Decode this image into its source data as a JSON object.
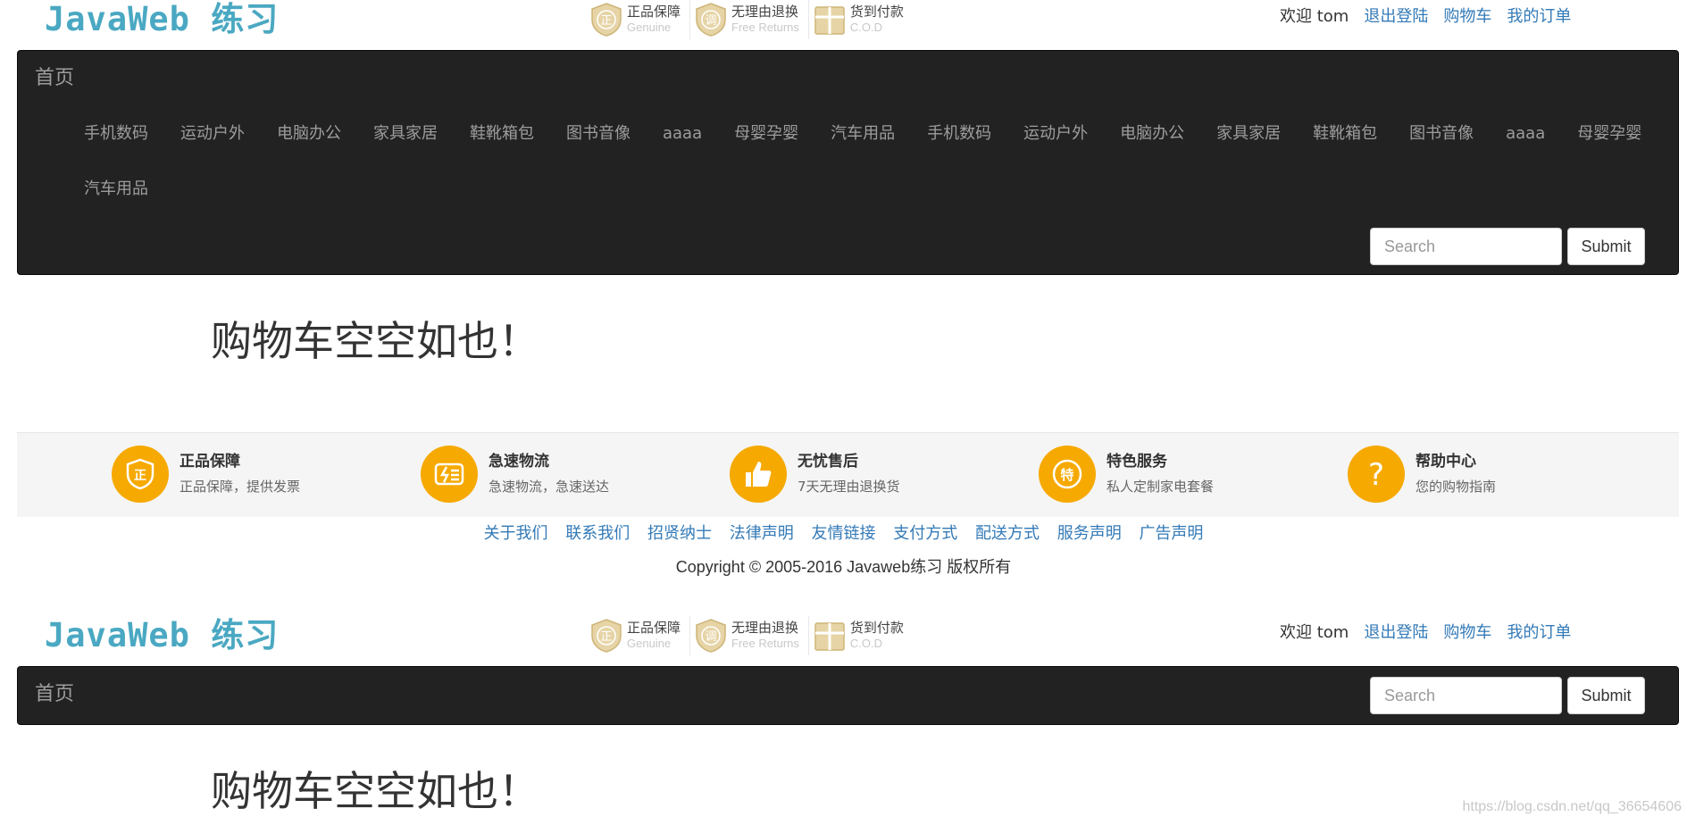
{
  "header": {
    "logo": "JavaWeb 练习",
    "badges": [
      {
        "main": "正品保障",
        "sub": "Genuine",
        "icon": "shield-zheng-icon",
        "glyph": "正"
      },
      {
        "main": "无理由退换",
        "sub": "Free Returns",
        "icon": "shield-tiao-icon",
        "glyph": "调"
      },
      {
        "main": "货到付款",
        "sub": "C.O.D",
        "icon": "gift-box-icon",
        "glyph": ""
      }
    ],
    "user_nav": {
      "welcome": "欢迎 tom",
      "logout": "退出登陆",
      "cart": "购物车",
      "orders": "我的订单"
    }
  },
  "navbar": {
    "brand": "首页",
    "categories": [
      "手机数码",
      "运动户外",
      "电脑办公",
      "家具家居",
      "鞋靴箱包",
      "图书音像",
      "aaaa",
      "母婴孕婴",
      "汽车用品",
      "手机数码",
      "运动户外",
      "电脑办公",
      "家具家居",
      "鞋靴箱包",
      "图书音像",
      "aaaa",
      "母婴孕婴",
      "汽车用品"
    ],
    "search_placeholder": "Search",
    "submit_label": "Submit"
  },
  "main": {
    "empty_cart": "购物车空空如也！"
  },
  "features": [
    {
      "title": "正品保障",
      "desc": "正品保障，提供发票",
      "icon": "shield-zheng-icon"
    },
    {
      "title": "急速物流",
      "desc": "急速物流，急速送达",
      "icon": "express-icon"
    },
    {
      "title": "无忧售后",
      "desc": "7天无理由退换货",
      "icon": "thumbs-up-icon"
    },
    {
      "title": "特色服务",
      "desc": "私人定制家电套餐",
      "icon": "te-badge-icon"
    },
    {
      "title": "帮助中心",
      "desc": "您的购物指南",
      "icon": "question-icon"
    }
  ],
  "footer": {
    "links": [
      "关于我们",
      "联系我们",
      "招贤纳士",
      "法律声明",
      "友情链接",
      "支付方式",
      "配送方式",
      "服务声明",
      "广告声明"
    ],
    "copyright": "Copyright © 2005-2016 Javaweb练习 版权所有"
  },
  "watermark": "https://blog.csdn.net/qq_36654606",
  "colors": {
    "navbar_bg": "#222222",
    "link": "#337ab7",
    "logo": "#4aa8c2",
    "feature_icon": "#f6a900"
  }
}
